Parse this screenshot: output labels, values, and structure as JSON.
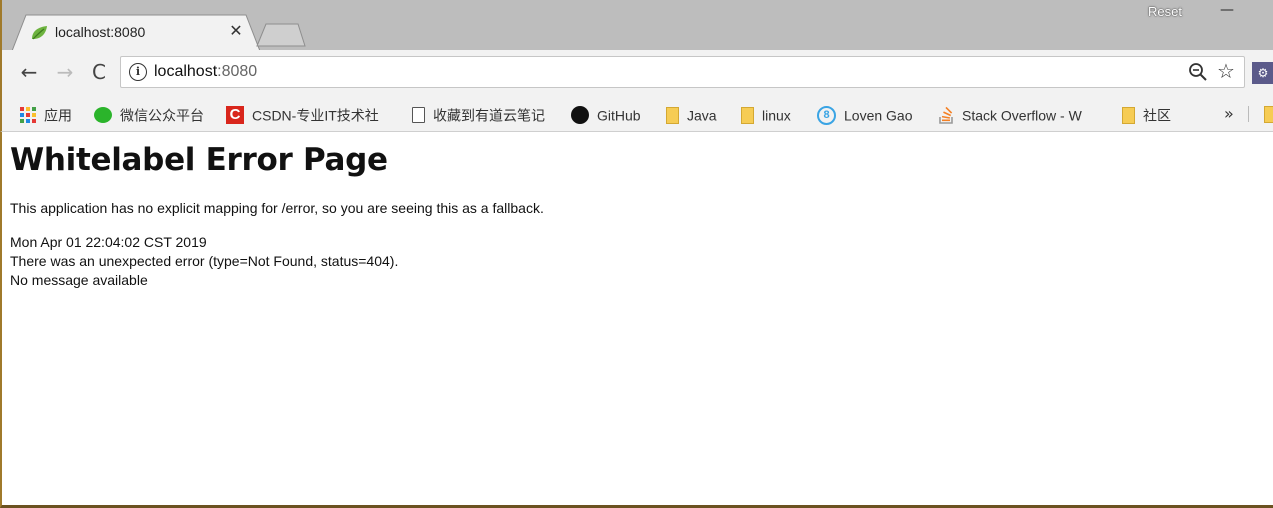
{
  "window": {
    "reset_label": "Reset",
    "minimize_glyph": "—"
  },
  "tab": {
    "title": "localhost:8080",
    "favicon": "spring-leaf-icon",
    "close_glyph": "✕"
  },
  "toolbar": {
    "back_glyph": "←",
    "forward_glyph": "→",
    "reload_glyph": "C",
    "info_glyph": "i",
    "url_host": "localhost",
    "url_port": ":8080",
    "star_glyph": "☆"
  },
  "bookmarks": [
    {
      "label": "应用",
      "icon": "apps-grid-icon"
    },
    {
      "label": "微信公众平台",
      "icon": "wechat-icon"
    },
    {
      "label": "CSDN-专业IT技术社",
      "icon": "csdn-icon"
    },
    {
      "label": "收藏到有道云笔记",
      "icon": "page-icon"
    },
    {
      "label": "GitHub",
      "icon": "github-icon"
    },
    {
      "label": "Java",
      "icon": "folder-icon"
    },
    {
      "label": "linux",
      "icon": "folder-icon"
    },
    {
      "label": "Loven Gao",
      "icon": "loven-icon"
    },
    {
      "label": "Stack Overflow - W",
      "icon": "stackoverflow-icon"
    },
    {
      "label": "社区",
      "icon": "folder-icon"
    }
  ],
  "bookmarks_more": "»",
  "page": {
    "title": "Whitelabel Error Page",
    "explanation": "This application has no explicit mapping for /error, so you are seeing this as a fallback.",
    "timestamp": "Mon Apr 01 22:04:02 CST 2019",
    "error_line": "There was an unexpected error (type=Not Found, status=404).",
    "message": "No message available"
  },
  "colors": {
    "titlebar": "#bdbdbd",
    "toolbar": "#f2f2f2",
    "folder": "#f6cc54",
    "csdn_red": "#d9261c",
    "wechat_green": "#2bb42b"
  }
}
